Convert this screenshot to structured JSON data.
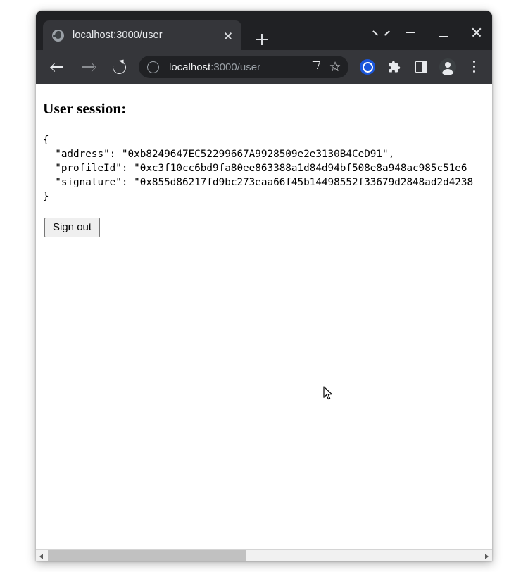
{
  "window": {
    "controls": {
      "tab_search_icon": "chevron-down-icon",
      "minimize_icon": "minimize-icon",
      "maximize_icon": "maximize-icon",
      "close_icon": "close-icon"
    }
  },
  "tabstrip": {
    "tabs": [
      {
        "title": "localhost:3000/user",
        "favicon": "globe-icon",
        "close_icon": "close-icon",
        "active": true
      }
    ],
    "new_tab_icon": "plus-icon"
  },
  "toolbar": {
    "back_icon": "arrow-left-icon",
    "forward_icon": "arrow-right-icon",
    "reload_icon": "reload-icon",
    "omnibox": {
      "security_icon": "info-circle-icon",
      "url_host": "localhost",
      "url_rest": ":3000/user",
      "url_full": "localhost:3000/user",
      "share_icon": "share-icon",
      "bookmark_icon": "star-icon",
      "star_glyph": "☆"
    },
    "actions": [
      {
        "name": "extension-blue-icon",
        "label": ""
      },
      {
        "name": "puzzle-icon",
        "label": ""
      },
      {
        "name": "side-panel-icon",
        "label": ""
      },
      {
        "name": "profile-avatar-icon",
        "label": ""
      },
      {
        "name": "kebab-menu-icon",
        "label": ""
      }
    ],
    "accent_color": "#1a56db"
  },
  "page": {
    "heading": "User session:",
    "session_json": "{\n  \"address\": \"0xb8249647EC52299667A9928509e2e3130B4CeD91\",\n  \"profileId\": \"0xc3f10cc6bd9fa80ee863388a1d84d94bf508e8a948ac985c51e6\n  \"signature\": \"0x855d86217fd9bc273eaa66f45b14498552f33679d2848ad2d4238\n}",
    "session": {
      "open_brace": "{",
      "address_key": "\"address\":",
      "address_value": "\"0xb8249647EC52299667A9928509e2e3130B4CeD91\",",
      "profileId_key": "\"profileId\":",
      "profileId_value": "\"0xc3f10cc6bd9fa80ee863388a1d84d94bf508e8a948ac985c51e6",
      "signature_key": "\"signature\":",
      "signature_value": "\"0x855d86217fd9bc273eaa66f45b14498552f33679d2848ad2d4238",
      "close_brace": "}"
    },
    "sign_out_label": "Sign out"
  },
  "scrollbar": {
    "left_arrow_icon": "triangle-left-icon",
    "right_arrow_icon": "triangle-right-icon",
    "thumb_start_pct": 0,
    "thumb_width_pct": 46
  }
}
